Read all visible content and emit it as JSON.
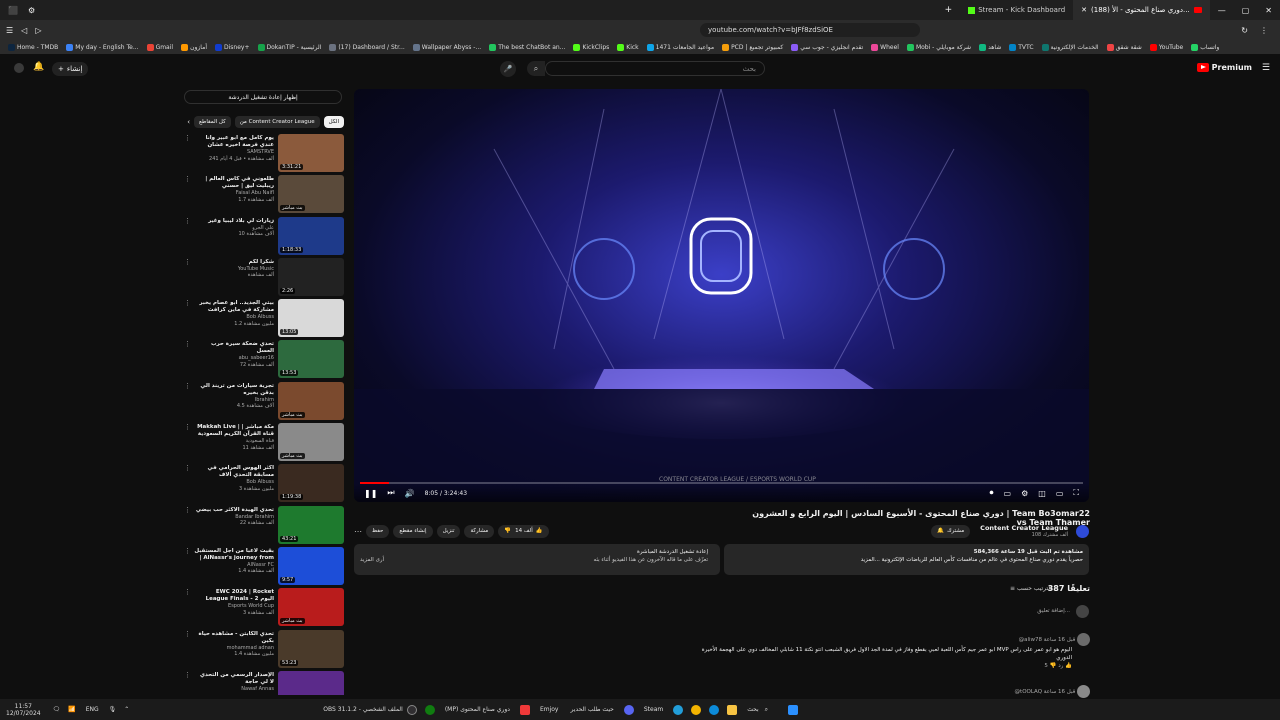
{
  "browser": {
    "tabs": [
      {
        "label": "Stream - Kick Dashboard",
        "active": false
      },
      {
        "label": "(188) دوري صناع المحتوى - الأ...",
        "active": true
      }
    ],
    "url": "youtube.com/watch?v=bJFf8zdSiOE",
    "bookmarks": [
      {
        "label": "Home - TMDB",
        "color": "#0d253f"
      },
      {
        "label": "My day - English Te...",
        "color": "#3b82f6"
      },
      {
        "label": "Gmail",
        "color": "#ea4335"
      },
      {
        "label": "أمازون",
        "color": "#ff9900"
      },
      {
        "label": "Disney+",
        "color": "#113ccf"
      },
      {
        "label": "DokanTIP - الرئيسية",
        "color": "#16a34a"
      },
      {
        "label": "(17) Dashboard / Str...",
        "color": "#6b7280"
      },
      {
        "label": "Wallpaper Abyss -...",
        "color": "#64748b"
      },
      {
        "label": "The best ChatBot an...",
        "color": "#22c55e"
      },
      {
        "label": "KickClips",
        "color": "#53fc18"
      },
      {
        "label": "Kick",
        "color": "#53fc18"
      },
      {
        "label": "مواعيد الجامعات 1471",
        "color": "#0ea5e9"
      },
      {
        "label": "PCD | كمبيوتر تجميع",
        "color": "#f59e0b"
      },
      {
        "label": "تقدم انجليزي - جوب سي",
        "color": "#8b5cf6"
      },
      {
        "label": "Wheel",
        "color": "#ec4899"
      },
      {
        "label": "Mobi - شركة موبايلي",
        "color": "#22c55e"
      },
      {
        "label": "شاهد",
        "color": "#10b981"
      },
      {
        "label": "TVTC",
        "color": "#0284c7"
      },
      {
        "label": "الخدمات الإلكترونية",
        "color": "#0f766e"
      },
      {
        "label": "شقة شقق",
        "color": "#ef4444"
      },
      {
        "label": "YouTube",
        "color": "#ff0000"
      },
      {
        "label": "واتساب",
        "color": "#25d366"
      }
    ]
  },
  "youtube": {
    "logo_text": "Premium",
    "search_placeholder": "بحث",
    "create_label": "إنشاء",
    "sidebar": {
      "live_chat_button": "إظهار إعادة تشغيل الدردشة",
      "chips": [
        "من Content Creator League",
        "Content Creator League",
        "كل المقاطع"
      ],
      "recommendations": [
        {
          "title": "يوم كامل مع ابو عبير وانا عندي فرصة اخيره عشان اثبت نفسي",
          "channel": "SAMSTRVE",
          "meta": "241 ألف مشاهدة • قبل 4 أيام",
          "duration": "3:31:21",
          "color": "#8b5a3c"
        },
        {
          "title": "طلعوني في كاس العالم | ريبليت ليق | حسني",
          "channel": "Faisal Abu Naifl",
          "meta": "1.7 ألف مشاهدة",
          "duration": "بث مباشر",
          "color": "#5a4a3a"
        },
        {
          "title": "زيارات لي بلاد ليبيا وغير",
          "channel": "علي الجرو",
          "meta": "10 آلاف مشاهدة",
          "duration": "1:18:33",
          "color": "#1e3a8a"
        },
        {
          "title": "شكرا لكم",
          "channel": "YouTube Music",
          "meta": "ألف مشاهدة",
          "duration": "2:26",
          "color": "#222222"
        },
        {
          "title": "بيتي الجديد.. أبو عصام يخبر مشاركة في ماين كرافت",
          "channel": "Bob Albuss",
          "meta": "1.2 مليون مشاهدة",
          "duration": "13:05",
          "color": "#d9d9d9"
        },
        {
          "title": "تحدي ضحكة سيرة حرب العسل",
          "channel": "abu_sabeer16",
          "meta": "72 ألف مشاهدة",
          "duration": "13:53",
          "color": "#2d6a3e"
        },
        {
          "title": "تجربة سيارات من تريند الي بدقن بخيره",
          "channel": "Ibrahim",
          "meta": "4.5 آلاف مشاهدة",
          "duration": "بث مباشر",
          "color": "#7b4a2e"
        },
        {
          "title": "Makkah Live | مكة مباشر | قناة القرآن الكريم السعودية",
          "channel": "قناة السعودية",
          "meta": "11 ألف مشاهد",
          "duration": "بث مباشر",
          "color": "#8a8a8a"
        },
        {
          "title": "أكثر الهوس الحرامي في مسابقة التحدي ألاف",
          "channel": "Bob Albuss",
          "meta": "3 مليون مشاهدة",
          "duration": "1:19:38",
          "color": "#3a2a20"
        },
        {
          "title": "تحدي الهيدة الأكثر حب بيضي",
          "channel": "Bandar Ibrahim",
          "meta": "22 ألف مشاهدة",
          "duration": "43:21",
          "color": "#1e7a2e"
        },
        {
          "title": "بقيت لاعبا من أجل المستقبل | AlNassr's journey from",
          "channel": "AlNassr FC",
          "meta": "1.4 ألف مشاهدة",
          "duration": "9:57",
          "color": "#1d4ed8"
        },
        {
          "title": "EWC 2024 | Rocket League Finals - اليوم 2",
          "channel": "Esports World Cup",
          "meta": "3 ألف مشاهدة",
          "duration": "بث مباشر",
          "color": "#b91c1c"
        },
        {
          "title": "تحدي الكابتن - مشاهده حياة بكين",
          "channel": "mohammad adnan",
          "meta": "1.4 مليون مشاهدة",
          "duration": "53:23",
          "color": "#4a3a2a"
        },
        {
          "title": "الإصدار الرسمي من التحدي لا لي حاجة",
          "channel": "Nawaf Annas",
          "meta": "",
          "duration": "",
          "color": "#5b2a8a"
        }
      ]
    },
    "player": {
      "time": "8:05 / 3:24:43",
      "progress": 0.04,
      "watermark": "CONTENT CREATOR LEAGUE / ESPORTS WORLD CUP"
    },
    "video": {
      "title": "دوري صناع المحتوى - الأسبوع السادس | اليوم الرابع و العشرون | Team Bo3omar22 vs Team Thamer",
      "channel": "Content Creator League",
      "subscribers": "108 ألف مشترك",
      "subscribe_label": "مشترك",
      "like_count": "14 ألف",
      "share_label": "مشاركة",
      "download_label": "تنزيل",
      "clip_label": "إنشاء مقطع",
      "save_label": "حفظ"
    },
    "description": {
      "stats": "584,366 مشاهدة  تم البث قبل 19 ساعة",
      "text": "حصرياً يقدم دوري صناع المحتوى في عالم من منافسات كأس العالم للرياضات الإلكترونية ...المزيد"
    },
    "live_chat_panel": {
      "title": "إعادة تشغيل الدردشة المباشرة",
      "subtitle": "تعرّف على ما قاله الآخرون عن هذا الفيديو أثناء بثه",
      "button": "أرى المزيد"
    },
    "comments": {
      "count_label": "387 تعليقًا",
      "sort_label": "الترتيب حسب",
      "add_placeholder": "إضافة تعليق...",
      "items": [
        {
          "author": "@aliw78  قبل 16 ساعة",
          "text": "ابو عمر جيم كأس اللعبة لعبي بقطع وفاز في لمدة الجد الاول فريق الشبعب انتو نكتة 11 شابلي المخالف دوي على الهجمة الأخيرة MVP اليوم هو ابو عمر على راس الدوري",
          "likes": "5",
          "color": "#6b6b6b"
        },
        {
          "author": "@tOOLAQ  قبل 16 ساعة",
          "text": "",
          "likes": "",
          "color": "#8a8a8a"
        }
      ]
    },
    "taskbar": {
      "time": "11:57",
      "date": "12/07/2024",
      "items": [
        "OBS 31.1.2 - الملف الشخصي",
        "(MP) دوري صناع المحتوى",
        "Emjoy",
        "حيث طلب الحدير",
        "Steam",
        "بحث"
      ],
      "lang": "ENG"
    }
  }
}
